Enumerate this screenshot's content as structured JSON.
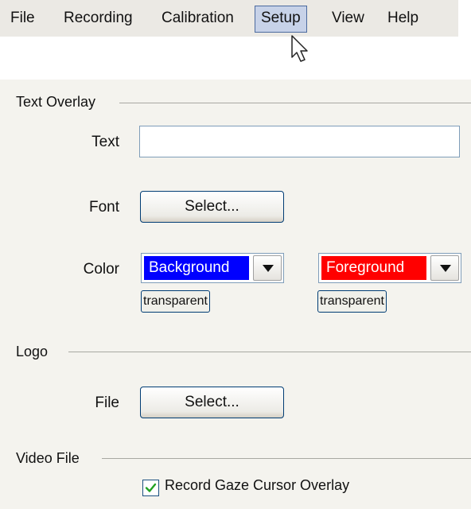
{
  "menu": {
    "items": [
      "File",
      "Recording",
      "Calibration",
      "Setup",
      "View",
      "Help"
    ],
    "active": "Setup"
  },
  "text_overlay": {
    "title": "Text Overlay",
    "text_label": "Text",
    "text_value": "",
    "font_label": "Font",
    "font_button": "Select...",
    "color_label": "Color",
    "background": {
      "label": "Background",
      "color": "#0000ff",
      "transparent_button": "transparent"
    },
    "foreground": {
      "label": "Foreground",
      "color": "#ff0000",
      "transparent_button": "transparent"
    },
    "dropdown_icon": "triangle-down-icon"
  },
  "logo": {
    "title": "Logo",
    "file_label": "File",
    "file_button": "Select..."
  },
  "video_file": {
    "title": "Video File",
    "checkbox_label": "Record Gaze Cursor Overlay",
    "checked": true
  }
}
